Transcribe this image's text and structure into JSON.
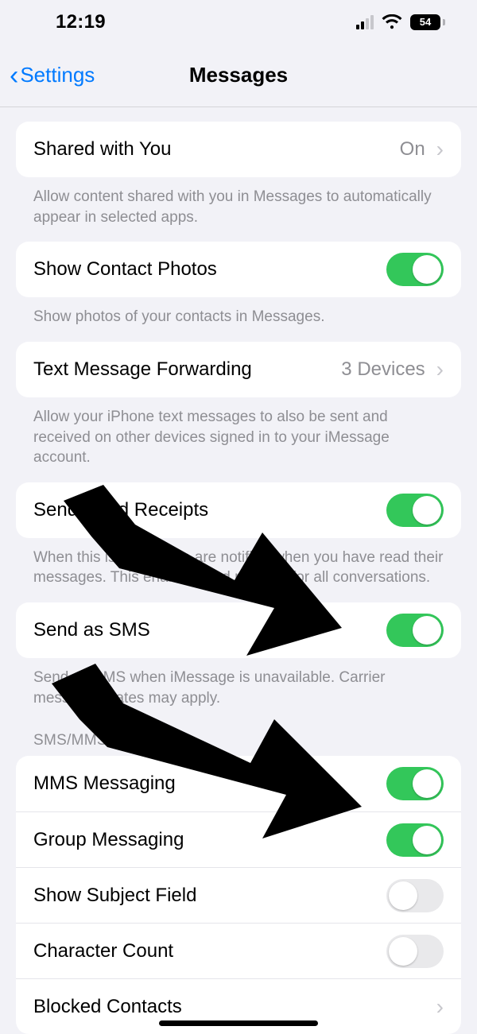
{
  "statusbar": {
    "time": "12:19",
    "battery_pct": "54",
    "signal_bars_on": 2
  },
  "nav": {
    "back_label": "Settings",
    "title": "Messages"
  },
  "rows": {
    "shared_with_you": {
      "label": "Shared with You",
      "value": "On"
    },
    "shared_with_you_footer": "Allow content shared with you in Messages to automatically appear in selected apps.",
    "show_contact_photos": {
      "label": "Show Contact Photos",
      "on": true
    },
    "show_contact_photos_footer": "Show photos of your contacts in Messages.",
    "text_forwarding": {
      "label": "Text Message Forwarding",
      "value": "3 Devices"
    },
    "text_forwarding_footer": "Allow your iPhone text messages to also be sent and received on other devices signed in to your iMessage account.",
    "read_receipts": {
      "label": "Send Read Receipts",
      "on": true
    },
    "read_receipts_footer": "When this is on, people are notified when you have read their messages. This enables read receipts for all conversations.",
    "send_as_sms": {
      "label": "Send as SMS",
      "on": true
    },
    "send_as_sms_footer": "Send as SMS when iMessage is unavailable. Carrier messaging rates may apply.",
    "sms_mms_header": "SMS/MMS",
    "mms_messaging": {
      "label": "MMS Messaging",
      "on": true
    },
    "group_messaging": {
      "label": "Group Messaging",
      "on": true
    },
    "show_subject": {
      "label": "Show Subject Field",
      "on": false
    },
    "char_count": {
      "label": "Character Count",
      "on": false
    },
    "blocked_contacts": {
      "label": "Blocked Contacts"
    }
  }
}
